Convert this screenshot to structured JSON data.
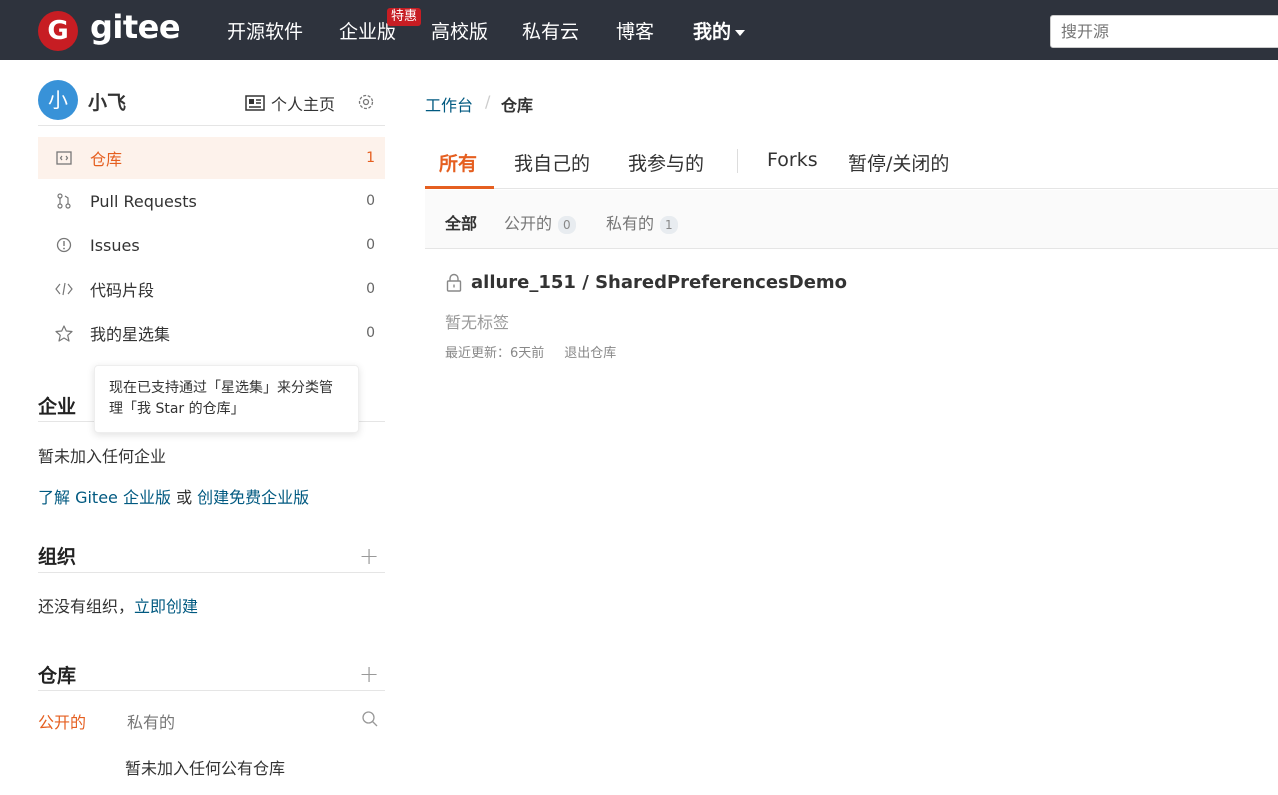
{
  "header": {
    "logo_letter": "G",
    "brand": "gitee",
    "nav": [
      "开源软件",
      "企业版",
      "高校版",
      "私有云",
      "博客",
      "我的"
    ],
    "badge": "特惠",
    "search_placeholder": "搜开源"
  },
  "sidebar": {
    "avatar_letter": "小",
    "username": "小飞",
    "homepage_label": "个人主页",
    "menu": [
      {
        "label": "仓库",
        "count": "1",
        "icon": "repo-icon"
      },
      {
        "label": "Pull Requests",
        "count": "0",
        "icon": "pull-request-icon"
      },
      {
        "label": "Issues",
        "count": "0",
        "icon": "issue-icon"
      },
      {
        "label": "代码片段",
        "count": "0",
        "icon": "code-icon"
      },
      {
        "label": "我的星选集",
        "count": "0",
        "icon": "star-icon"
      }
    ],
    "tooltip": "现在已支持通过「星选集」来分类管理「我 Star 的仓库」",
    "enterprise": {
      "title": "企业",
      "empty": "暂未加入任何企业",
      "link_learn": "了解 Gitee 企业版",
      "or": " 或 ",
      "link_create": "创建免费企业版"
    },
    "org": {
      "title": "组织",
      "empty": "还没有组织，",
      "link_create": "立即创建"
    },
    "repos": {
      "title": "仓库",
      "tab_public": "公开的",
      "tab_private": "私有的",
      "empty": "暂未加入任何公有仓库"
    }
  },
  "main": {
    "breadcrumb_root": "工作台",
    "breadcrumb_sep": "/",
    "breadcrumb_current": "仓库",
    "tabs": [
      "所有",
      "我自己的",
      "我参与的",
      "Forks",
      "暂停/关闭的"
    ],
    "subtabs": [
      {
        "label": "全部",
        "count": ""
      },
      {
        "label": "公开的",
        "count": "0"
      },
      {
        "label": "私有的",
        "count": "1"
      }
    ],
    "repo": {
      "name": "allure_151 / SharedPreferencesDemo",
      "tags": "暂无标签",
      "updated": "最近更新：6天前",
      "quit": "退出仓库"
    }
  },
  "colors": {
    "accent": "#e55f20",
    "header_bg": "#2e333d",
    "brand_red": "#c71d23",
    "link": "#005980",
    "avatar": "#3892d8"
  }
}
